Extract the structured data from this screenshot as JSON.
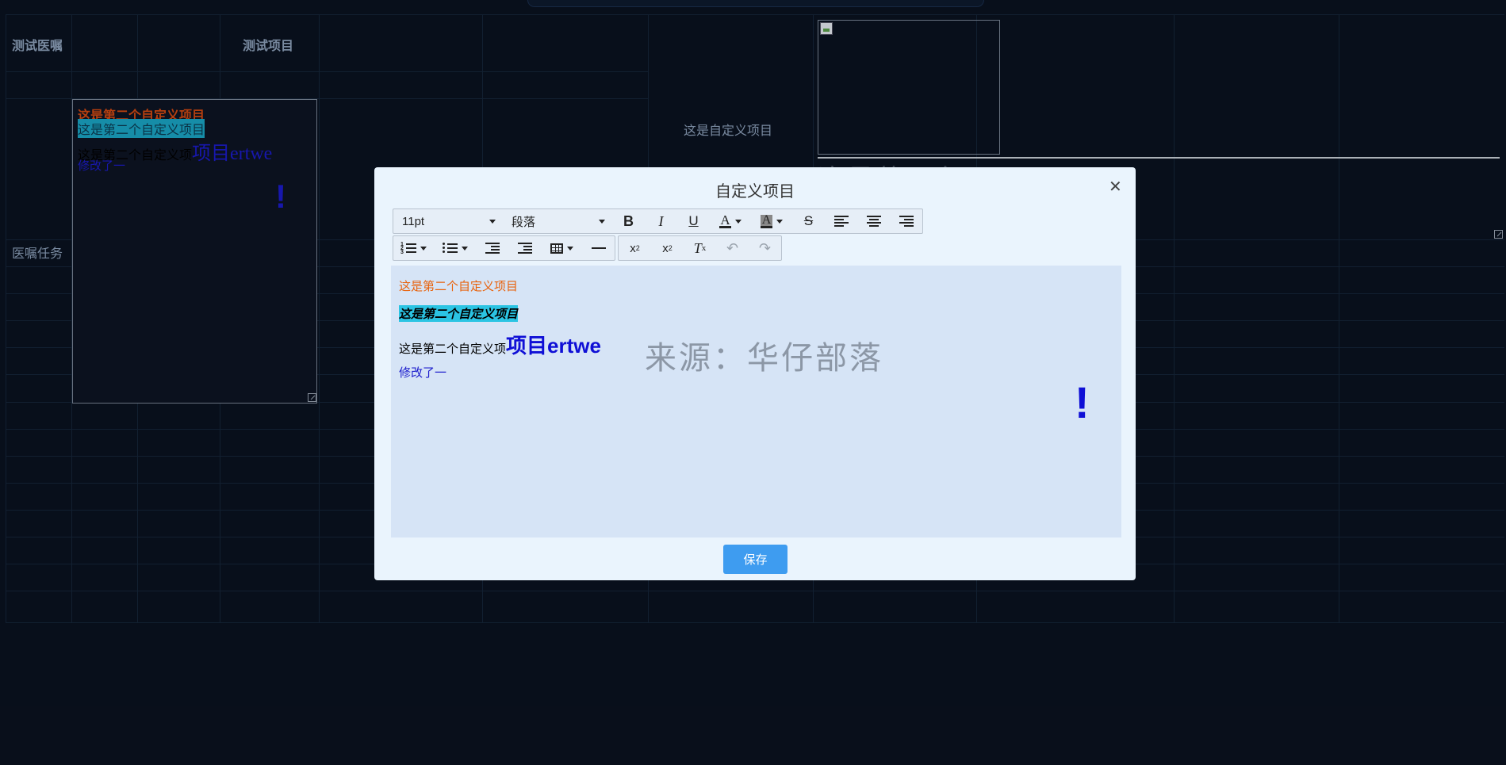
{
  "background": {
    "table_headers": [
      "测试医嘱",
      "测试项目"
    ],
    "row_label": "医嘱任务",
    "custom_item_label": "这是自定义项目",
    "preview": {
      "line1": "这是第二个自定义项目",
      "line2": "这是第二个自定义项目",
      "line3_prefix": "这是第二个自定义项",
      "line3_big": "项目ertwe",
      "line4": "修改了一",
      "exclamation": "!"
    },
    "ghost_text": "这是第一行"
  },
  "dialog": {
    "title": "自定义项目",
    "close_icon": "close-icon",
    "toolbar": {
      "font_size": "11pt",
      "block_format": "段落",
      "buttons_row1": [
        "bold-icon",
        "italic-icon",
        "underline-icon",
        "font-color-icon",
        "background-color-icon",
        "strikethrough-icon",
        "align-left-icon",
        "align-center-icon",
        "align-right-icon"
      ],
      "buttons_row2": [
        "numbered-list-icon",
        "bullet-list-icon",
        "outdent-icon",
        "indent-icon",
        "table-icon",
        "horizontal-rule-icon",
        "subscript-icon",
        "superscript-icon",
        "clear-format-icon",
        "undo-icon",
        "redo-icon"
      ]
    },
    "editor": {
      "line1": "这是第二个自定义项目",
      "line2": "这是第二个自定义项目",
      "line3_prefix": "这是第二个自定义项",
      "line3_big": "项目ertwe",
      "line4": "修改了一",
      "exclamation": "!",
      "watermark": "来源：华仔部落"
    },
    "save_label": "保存"
  },
  "colors": {
    "accent": "#3e9cf0",
    "orange_text": "#e8620c",
    "blue_text": "#0f0fd6",
    "highlight_cyan": "#2bc4e3",
    "page_background": "#0a1220"
  }
}
